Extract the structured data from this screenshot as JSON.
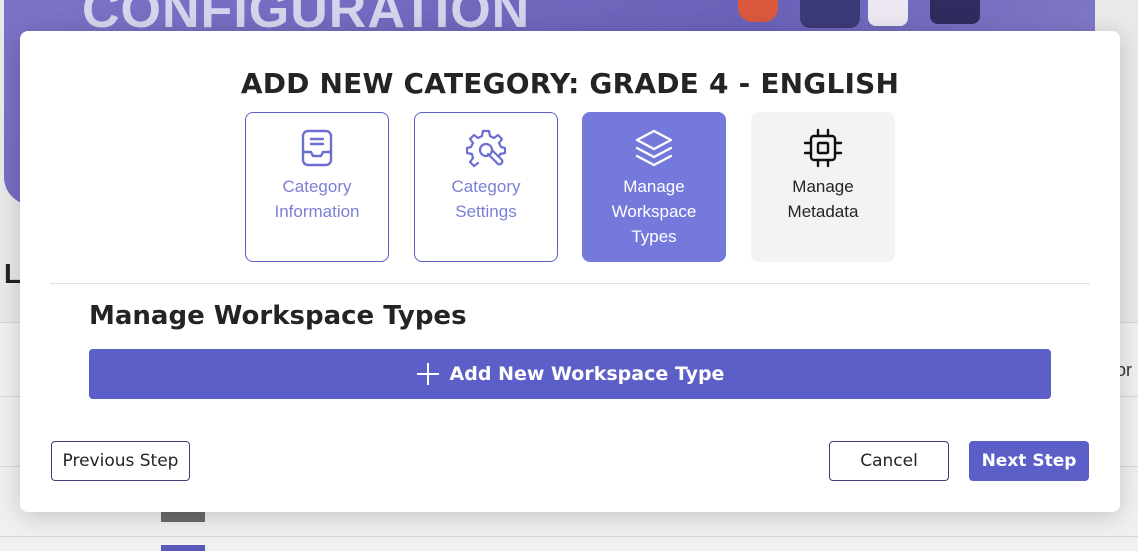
{
  "background": {
    "banner_title": "CONFIGURATION",
    "heading_letter": "L",
    "column_fragment": "or"
  },
  "modal": {
    "title": "ADD NEW CATEGORY: GRADE 4 - ENGLISH",
    "steps": [
      {
        "label": "Category Information",
        "icon": "inbox-tray-icon",
        "state": "done"
      },
      {
        "label": "Category Settings",
        "icon": "gear-wrench-icon",
        "state": "done"
      },
      {
        "label": "Manage Workspace Types",
        "icon": "layers-icon",
        "state": "active"
      },
      {
        "label": "Manage Metadata",
        "icon": "chip-icon",
        "state": "pending"
      }
    ],
    "section_title": "Manage Workspace Types",
    "add_button_label": "Add New Workspace Type",
    "previous_label": "Previous Step",
    "cancel_label": "Cancel",
    "next_label": "Next Step"
  },
  "colors": {
    "accent": "#5b5fc7",
    "active_step": "#7579db",
    "done_step_text": "#7b7fd6",
    "pending_step_bg": "#f3f3f3"
  }
}
